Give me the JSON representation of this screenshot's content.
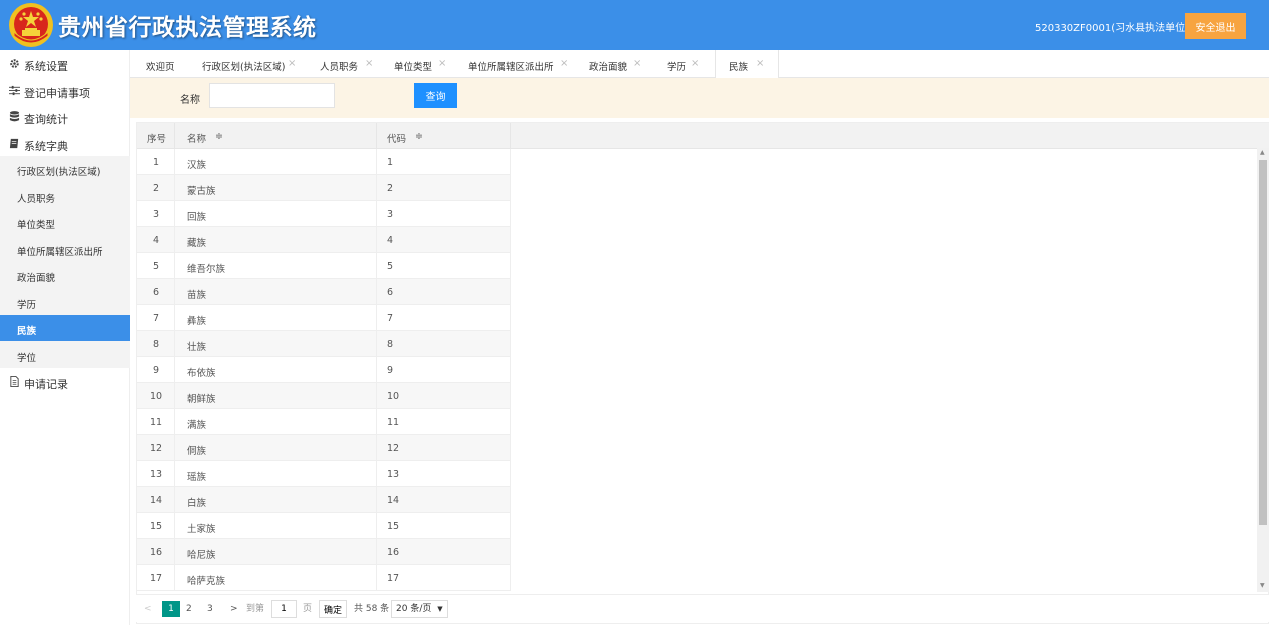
{
  "header": {
    "title": "贵州省行政执法管理系统",
    "user": "520330ZF0001(习水县执法单位)",
    "logout_label": "安全退出"
  },
  "colors": {
    "header_bg": "#3b8fe8",
    "logout_bg": "#f7a440",
    "query_bg": "#1e90ff",
    "active_menu_bg": "#3b8fe8",
    "pager_current_bg": "#009688",
    "search_panel_bg": "#fcf4e5"
  },
  "sidebar": {
    "groups": [
      {
        "label": "系统设置",
        "icon": "gear-icon"
      },
      {
        "label": "登记申请事项",
        "icon": "sliders-icon"
      },
      {
        "label": "查询统计",
        "icon": "database-icon"
      },
      {
        "label": "系统字典",
        "icon": "book-icon"
      }
    ],
    "dict_items": [
      "行政区划(执法区域)",
      "人员职务",
      "单位类型",
      "单位所属辖区派出所",
      "政治面貌",
      "学历",
      "民族",
      "学位"
    ],
    "active_item": "民族",
    "records": {
      "label": "申请记录",
      "icon": "document-icon"
    }
  },
  "tabs": [
    {
      "label": "欢迎页",
      "closable": false
    },
    {
      "label": "行政区划(执法区域)",
      "closable": true
    },
    {
      "label": "人员职务",
      "closable": true
    },
    {
      "label": "单位类型",
      "closable": true
    },
    {
      "label": "单位所属辖区派出所",
      "closable": true
    },
    {
      "label": "政治面貌",
      "closable": true
    },
    {
      "label": "学历",
      "closable": true
    },
    {
      "label": "民族",
      "closable": true,
      "active": true
    }
  ],
  "tab_close_glyph": "×",
  "search": {
    "label": "名称",
    "value": "",
    "placeholder": "",
    "button": "查询"
  },
  "table": {
    "columns": [
      "序号",
      "名称",
      "代码"
    ],
    "sort_glyph": "≑",
    "rows": [
      [
        "1",
        "汉族",
        "1"
      ],
      [
        "2",
        "蒙古族",
        "2"
      ],
      [
        "3",
        "回族",
        "3"
      ],
      [
        "4",
        "藏族",
        "4"
      ],
      [
        "5",
        "维吾尔族",
        "5"
      ],
      [
        "6",
        "苗族",
        "6"
      ],
      [
        "7",
        "彝族",
        "7"
      ],
      [
        "8",
        "壮族",
        "8"
      ],
      [
        "9",
        "布依族",
        "9"
      ],
      [
        "10",
        "朝鲜族",
        "10"
      ],
      [
        "11",
        "满族",
        "11"
      ],
      [
        "12",
        "侗族",
        "12"
      ],
      [
        "13",
        "瑶族",
        "13"
      ],
      [
        "14",
        "白族",
        "14"
      ],
      [
        "15",
        "土家族",
        "15"
      ],
      [
        "16",
        "哈尼族",
        "16"
      ],
      [
        "17",
        "哈萨克族",
        "17"
      ]
    ]
  },
  "pagination": {
    "prev": "<",
    "next": ">",
    "pages": [
      "1",
      "2",
      "3"
    ],
    "current": "1",
    "goto_label": "到第",
    "goto_value": "1",
    "page_suffix": "页",
    "confirm": "确定",
    "total": "共 58 条",
    "page_size": "20 条/页"
  }
}
